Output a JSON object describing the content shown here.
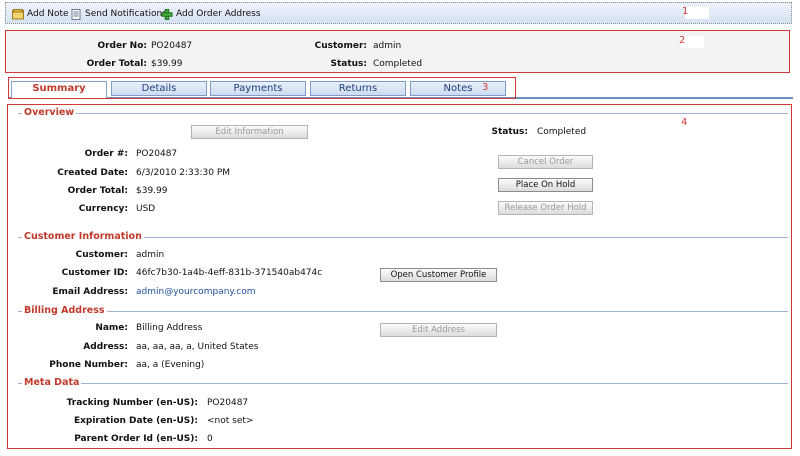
{
  "toolbar": {
    "add_note": "Add Note",
    "send_notifications": "Send Notifications",
    "add_order_address": "Add Order Address",
    "marker": "1"
  },
  "header": {
    "marker": "2",
    "order_no_label": "Order No:",
    "order_no_value": "PO20487",
    "order_total_label": "Order Total:",
    "order_total_value": "$39.99",
    "customer_label": "Customer:",
    "customer_value": "admin",
    "status_label": "Status:",
    "status_value": "Completed"
  },
  "tabs": {
    "marker": "3",
    "items": [
      {
        "label": "Summary",
        "active": true
      },
      {
        "label": "Details",
        "active": false
      },
      {
        "label": "Payments",
        "active": false
      },
      {
        "label": "Returns",
        "active": false
      },
      {
        "label": "Notes",
        "active": false
      }
    ]
  },
  "main": {
    "marker": "4",
    "overview": {
      "title": "Overview",
      "edit_button": "Edit Information",
      "status_label": "Status:",
      "status_value": "Completed",
      "order_num_label": "Order #:",
      "order_num_value": "PO20487",
      "created_label": "Created Date:",
      "created_value": "6/3/2010 2:33:30 PM",
      "total_label": "Order Total:",
      "total_value": "$39.99",
      "currency_label": "Currency:",
      "currency_value": "USD",
      "cancel_button": "Cancel Order",
      "hold_button": "Place On Hold",
      "release_button": "Release Order Hold"
    },
    "customer": {
      "title": "Customer Information",
      "customer_label": "Customer:",
      "customer_value": "admin",
      "id_label": "Customer ID:",
      "id_value": "46fc7b30-1a4b-4eff-831b-371540ab474c",
      "email_label": "Email Address:",
      "email_value": "admin@yourcompany.com",
      "profile_button": "Open Customer Profile"
    },
    "billing": {
      "title": "Billing Address",
      "name_label": "Name:",
      "name_value": "Billing Address",
      "address_label": "Address:",
      "address_value": "aa, aa, aa, a, United States",
      "phone_label": "Phone Number:",
      "phone_value": "aa, a (Evening)",
      "edit_button": "Edit Address"
    },
    "meta": {
      "title": "Meta Data",
      "tracking_label": "Tracking Number (en-US):",
      "tracking_value": "PO20487",
      "expiration_label": "Expiration Date (en-US):",
      "expiration_value": "<not set>",
      "parent_label": "Parent Order Id (en-US):",
      "parent_value": "0"
    }
  }
}
